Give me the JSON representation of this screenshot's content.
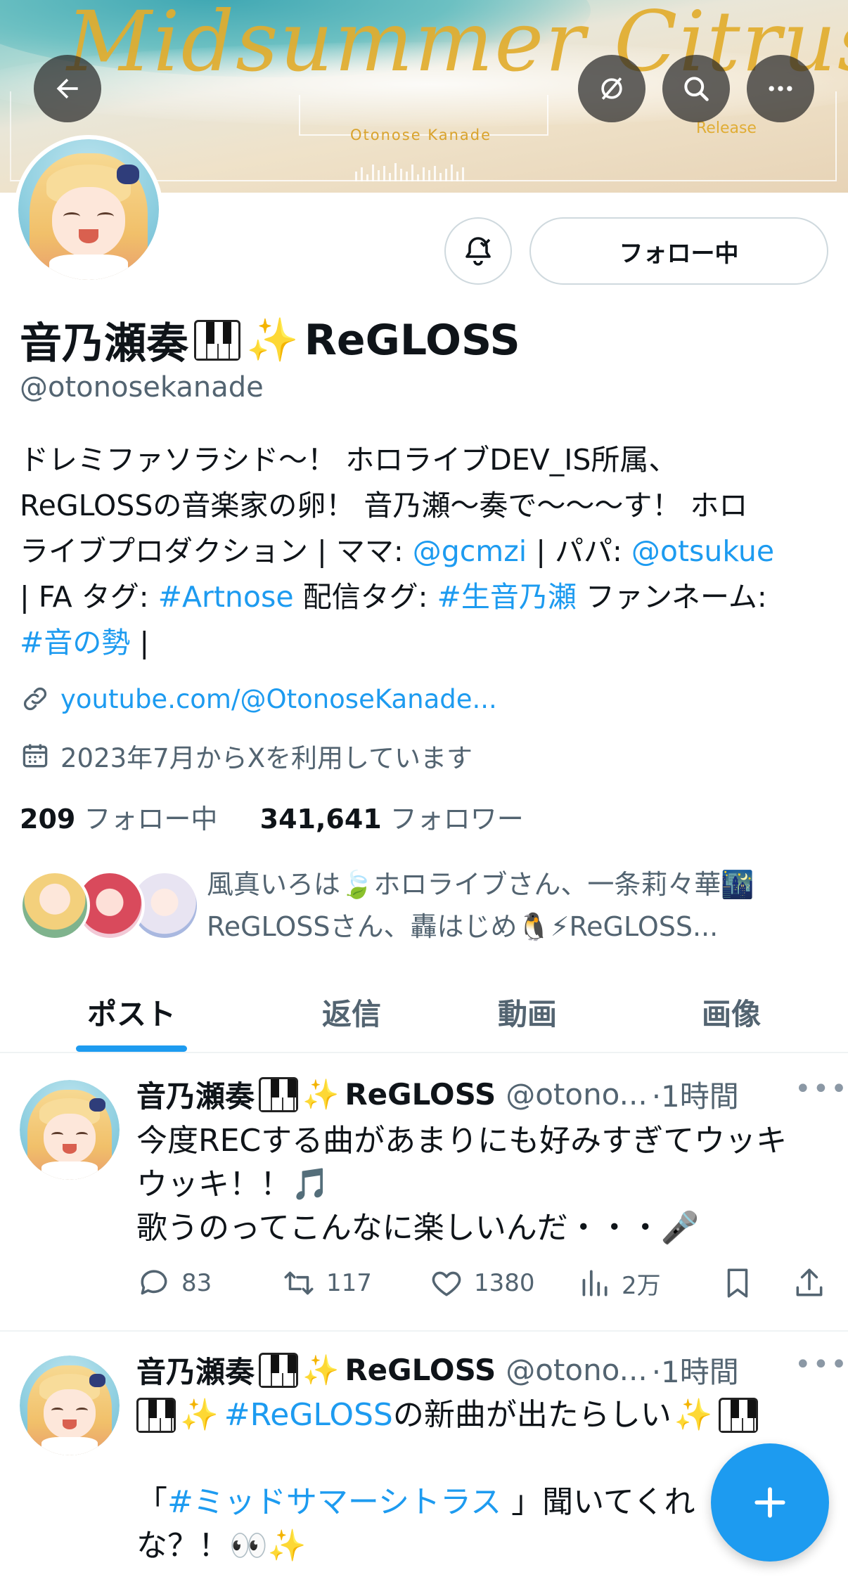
{
  "banner": {
    "title": "Midsummer Citrus",
    "subtitle": "Otonose Kanade",
    "release": "Release"
  },
  "profile": {
    "display_name": "音乃瀬奏",
    "name_suffix": "ReGLOSS",
    "handle": "@otonosekanade",
    "follow_button": "フォロー中",
    "bio_line1": "ドレミファソラシド〜！ ホロライブDEV_IS所属、",
    "bio_line2": "ReGLOSSの音楽家の卵！ 音乃瀬〜奏で〜〜〜す！ ホロ",
    "bio_line3_a": "ライブプロダクション | ママ: ",
    "bio_mention_mama": "@gcmzi",
    "bio_line3_b": " | パパ: ",
    "bio_mention_papa": "@otsukue",
    "bio_line4_a": "| FA タグ: ",
    "bio_tag_fa": "#Artnose",
    "bio_line4_b": " 配信タグ: ",
    "bio_tag_stream": "#生音乃瀬",
    "bio_line4_c": " ファンネーム:",
    "bio_tag_fan": "#音の勢",
    "bio_line5_b": " |",
    "website": "youtube.com/@OtonoseKanade...",
    "joined": "2023年7月からXを利用しています",
    "following_count": "209",
    "following_label": "フォロー中",
    "followers_count": "341,641",
    "followers_label": "フォロワー",
    "followed_by_line1": "風真いろは🍃ホロライブさん、一条莉々華🌃",
    "followed_by_line2": "ReGLOSSさん、轟はじめ🐧⚡ReGLOSS..."
  },
  "tabs": [
    {
      "label": "ポスト",
      "active": true
    },
    {
      "label": "返信",
      "active": false
    },
    {
      "label": "動画",
      "active": false
    },
    {
      "label": "画像",
      "active": false
    }
  ],
  "posts": [
    {
      "name": "音乃瀬奏",
      "name_suffix": "ReGLOSS",
      "handle": "@otono...",
      "time": "·1時間",
      "line1": "今度RECする曲があまりにも好みすぎてウッキ",
      "line2": "ウッキ！！🎵",
      "line3": "歌うのってこんなに楽しいんだ・・・🎤",
      "replies": "83",
      "reposts": "117",
      "likes": "1380",
      "views": "2万"
    },
    {
      "name": "音乃瀬奏",
      "name_suffix": "ReGLOSS",
      "handle": "@otono...",
      "time": "·1時間",
      "line1_tag": "#ReGLOSS",
      "line1_rest": " の新曲が出たらしい",
      "line2_a": "「",
      "line2_tag": "#ミッドサマーシトラス",
      "line2_b": " 」聞いてくれ",
      "line3": "な？！👀✨"
    }
  ],
  "colors": {
    "accent": "#1d9bf0",
    "text": "#0f1419",
    "secondary": "#536471"
  }
}
